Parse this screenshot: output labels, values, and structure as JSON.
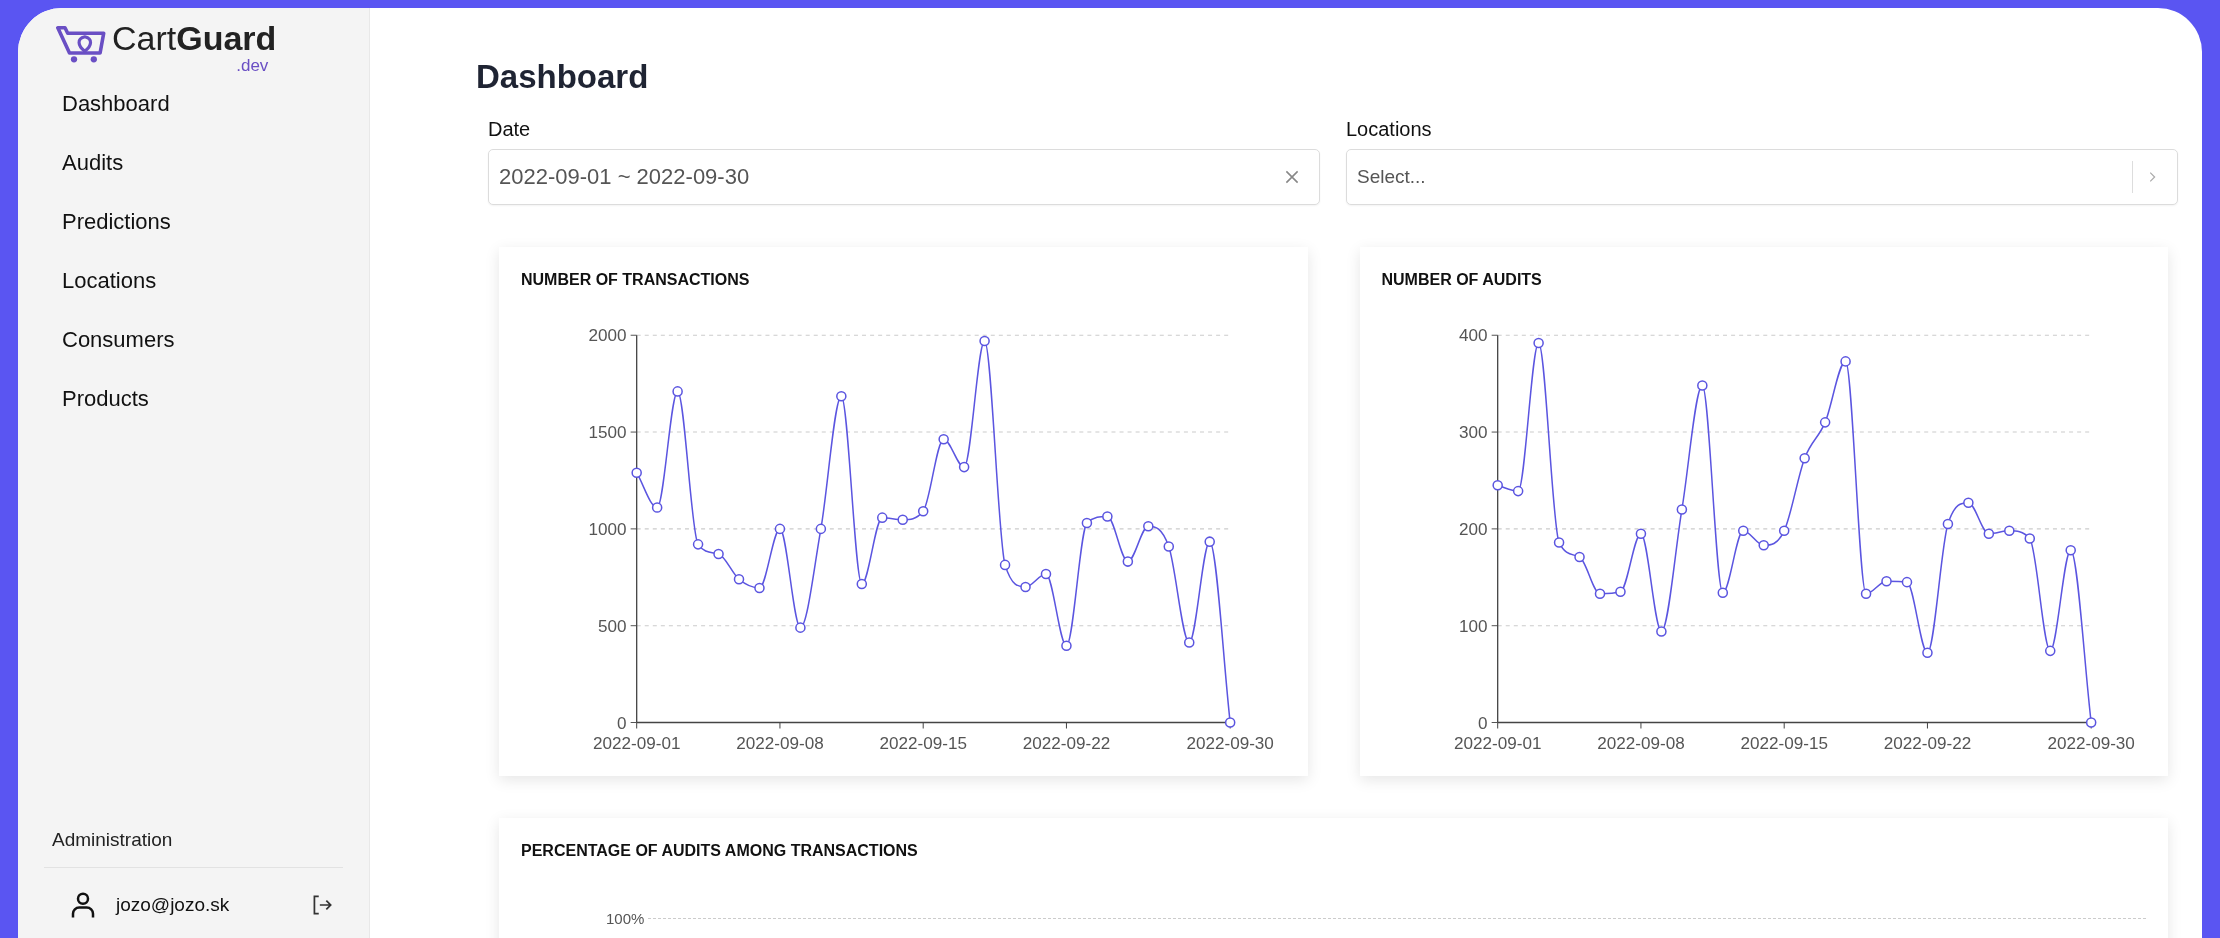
{
  "sidebar": {
    "logo": {
      "name": "Cart**Guard**",
      "suffix": ".dev"
    },
    "items": [
      {
        "label": "Dashboard"
      },
      {
        "label": "Audits"
      },
      {
        "label": "Predictions"
      },
      {
        "label": "Locations"
      },
      {
        "label": "Consumers"
      },
      {
        "label": "Products"
      }
    ],
    "section": "Administration",
    "user": {
      "email": "jozo@jozo.sk"
    }
  },
  "main": {
    "title": "Dashboard",
    "filters": [
      {
        "kind": "daterange",
        "label": "Date",
        "value": "2022-09-01 ~ 2022-09-30"
      },
      {
        "kind": "select",
        "label": "Locations",
        "placeholder": "Select..."
      }
    ],
    "charts": [
      {
        "title": "NUMBER OF TRANSACTIONS",
        "chart_data": {
          "type": "line",
          "grid": true,
          "categories": [
            "2022-09-01",
            null,
            null,
            null,
            null,
            null,
            null,
            "2022-09-08",
            null,
            null,
            null,
            null,
            null,
            null,
            "2022-09-15",
            null,
            null,
            null,
            null,
            null,
            null,
            "2022-09-22",
            null,
            null,
            null,
            null,
            null,
            null,
            null,
            "2022-09-30"
          ],
          "series": [
            {
              "color": "#5b55e0",
              "marker": "circle",
              "values": [
                1290,
                1110,
                1710,
                920,
                870,
                740,
                695,
                1000,
                490,
                1000,
                1685,
                715,
                1058,
                1047,
                1091,
                1463,
                1319,
                1970,
                814,
                700,
                767,
                396,
                1030,
                1064,
                831,
                1014,
                909,
                413,
                934,
                0
              ]
            }
          ],
          "ylim": [
            0,
            2000
          ],
          "yticks": [
            0,
            500,
            1000,
            1500,
            2000
          ]
        }
      },
      {
        "title": "NUMBER OF AUDITS",
        "chart_data": {
          "type": "line",
          "grid": true,
          "categories": [
            "2022-09-01",
            null,
            null,
            null,
            null,
            null,
            null,
            "2022-09-08",
            null,
            null,
            null,
            null,
            null,
            null,
            "2022-09-15",
            null,
            null,
            null,
            null,
            null,
            null,
            "2022-09-22",
            null,
            null,
            null,
            null,
            null,
            null,
            null,
            "2022-09-30"
          ],
          "series": [
            {
              "color": "#5b55e0",
              "marker": "circle",
              "values": [
                245,
                239,
                392,
                186,
                171,
                133,
                135,
                195,
                94,
                220,
                348,
                134,
                198,
                183,
                198,
                273,
                310,
                373,
                133,
                146,
                145,
                72,
                205,
                227,
                195,
                198,
                190,
                74,
                178,
                0
              ]
            }
          ],
          "ylim": [
            0,
            400
          ],
          "yticks": [
            0,
            100,
            200,
            300,
            400
          ]
        }
      }
    ],
    "partial_chart": {
      "title": "PERCENTAGE OF AUDITS AMONG TRANSACTIONS",
      "ytick": "100%"
    }
  }
}
